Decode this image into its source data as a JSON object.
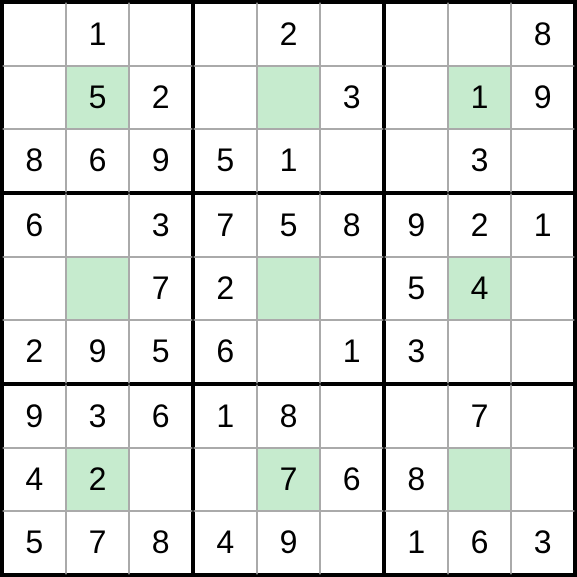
{
  "sudoku": {
    "grid": [
      [
        "",
        "1",
        "",
        "",
        "2",
        "",
        "",
        "",
        "8"
      ],
      [
        "",
        "5",
        "2",
        "",
        "",
        "3",
        "",
        "1",
        "9"
      ],
      [
        "8",
        "6",
        "9",
        "5",
        "1",
        "",
        "",
        "3",
        ""
      ],
      [
        "6",
        "",
        "3",
        "7",
        "5",
        "8",
        "9",
        "2",
        "1"
      ],
      [
        "",
        "",
        "7",
        "2",
        "",
        "",
        "5",
        "4",
        ""
      ],
      [
        "2",
        "9",
        "5",
        "6",
        "",
        "1",
        "3",
        "",
        ""
      ],
      [
        "9",
        "3",
        "6",
        "1",
        "8",
        "",
        "",
        "7",
        ""
      ],
      [
        "4",
        "2",
        "",
        "",
        "7",
        "6",
        "8",
        "",
        ""
      ],
      [
        "5",
        "7",
        "8",
        "4",
        "9",
        "",
        "1",
        "6",
        "3"
      ]
    ],
    "highlights": [
      [
        1,
        1
      ],
      [
        1,
        4
      ],
      [
        1,
        7
      ],
      [
        4,
        1
      ],
      [
        4,
        4
      ],
      [
        4,
        7
      ],
      [
        7,
        1
      ],
      [
        7,
        4
      ],
      [
        7,
        7
      ]
    ]
  }
}
